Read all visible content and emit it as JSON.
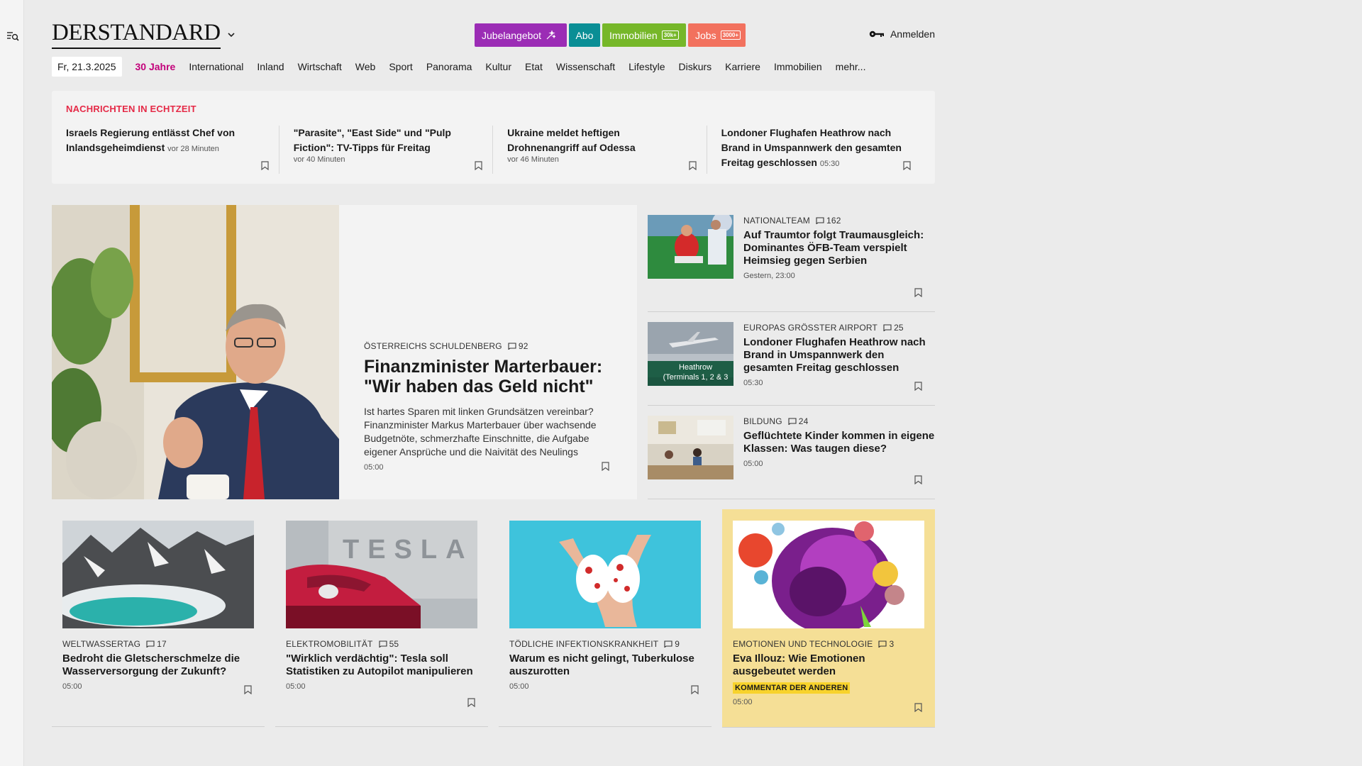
{
  "header": {
    "logo": "DERSTANDARD",
    "promos": {
      "jubel": "Jubelangebot",
      "abo": "Abo",
      "immobilien": "Immobilien",
      "immobilien_badge": "30k+",
      "jobs": "Jobs",
      "jobs_badge": "3000+"
    },
    "login": "Anmelden"
  },
  "nav": {
    "date": "Fr, 21.3.2025",
    "items": [
      "30 Jahre",
      "International",
      "Inland",
      "Wirtschaft",
      "Web",
      "Sport",
      "Panorama",
      "Kultur",
      "Etat",
      "Wissenschaft",
      "Lifestyle",
      "Diskurs",
      "Karriere",
      "Immobilien",
      "mehr..."
    ]
  },
  "ticker": {
    "heading": "NACHRICHTEN IN ECHTZEIT",
    "items": [
      {
        "title": "Israels Regierung entlässt Chef von Inlandsgeheimdienst",
        "time": "vor 28 Minuten"
      },
      {
        "title": "\"Parasite\", \"East Side\" und \"Pulp Fiction\": TV-Tipps für Freitag",
        "time": "vor 40 Minuten"
      },
      {
        "title": "Ukraine meldet heftigen Drohnenangriff auf Odessa",
        "time": "vor 46 Minuten"
      },
      {
        "title": "Londoner Flughafen Heathrow nach Brand in Umspannwerk den gesamten Freitag geschlossen",
        "time": "05:30"
      }
    ]
  },
  "hero": {
    "kicker": "ÖSTERREICHS SCHULDENBERG",
    "comments": "92",
    "title": "Finanzminister Marterbauer: \"Wir haben das Geld nicht\"",
    "teaser": "Ist hartes Sparen mit linken Grundsätzen vereinbar? Finanzminister Markus Marterbauer über wachsende Budgetnöte, schmerzhafte Einschnitte, die Aufgabe eigener Ansprüche und die Naivität des Neulings",
    "time": "05:00"
  },
  "side": [
    {
      "kicker": "NATIONALTEAM",
      "comments": "162",
      "title": "Auf Traumtor folgt Traumausgleich: Dominantes ÖFB-Team verspielt Heimsieg gegen Serbien",
      "time": "Gestern, 23:00"
    },
    {
      "kicker": "EUROPAS GRÖSSTER AIRPORT",
      "comments": "25",
      "title": "Londoner Flughafen Heathrow nach Brand in Umspannwerk den gesamten Freitag geschlossen",
      "time": "05:30",
      "sign_text_1": "Heathrow",
      "sign_text_2": "(Terminals 1, 2 & 3"
    },
    {
      "kicker": "BILDUNG",
      "comments": "24",
      "title": "Geflüchtete Kinder kommen in eigene Klassen: Was taugen diese?",
      "time": "05:00"
    }
  ],
  "cards": [
    {
      "kicker": "WELTWASSERTAG",
      "comments": "17",
      "title": "Bedroht die Gletscherschmelze die Wasserversorgung der Zukunft?",
      "time": "05:00"
    },
    {
      "kicker": "ELEKTROMOBILITÄT",
      "comments": "55",
      "title": "\"Wirklich verdächtig\": Tesla soll Statistiken zu Autopilot manipulieren",
      "time": "05:00",
      "wall_text": "TESLA"
    },
    {
      "kicker": "TÖDLICHE INFEKTIONSKRANKHEIT",
      "comments": "9",
      "title": "Warum es nicht gelingt, Tuberkulose auszurotten",
      "time": "05:00"
    },
    {
      "kicker": "EMOTIONEN UND TECHNOLOGIE",
      "comments": "3",
      "title": "Eva Illouz: Wie Emotionen ausgebeutet werden",
      "badge": "KOMMENTAR DER ANDEREN",
      "time": "05:00"
    }
  ],
  "colors": {
    "ticker_heading": "#e52a47",
    "nav_accent": "#c2007a",
    "promo_jubel": "#9b2cb5",
    "promo_abo": "#0a8e95",
    "promo_immobilien": "#76b729",
    "promo_jobs": "#f2715e",
    "opinion_bg": "#f5df96",
    "opinion_badge": "#f8d32c"
  },
  "icons": [
    "menu-search-icon",
    "chevron-down-icon",
    "sparkle-icon",
    "key-icon",
    "comment-icon",
    "bookmark-icon",
    "airplane-icon"
  ]
}
